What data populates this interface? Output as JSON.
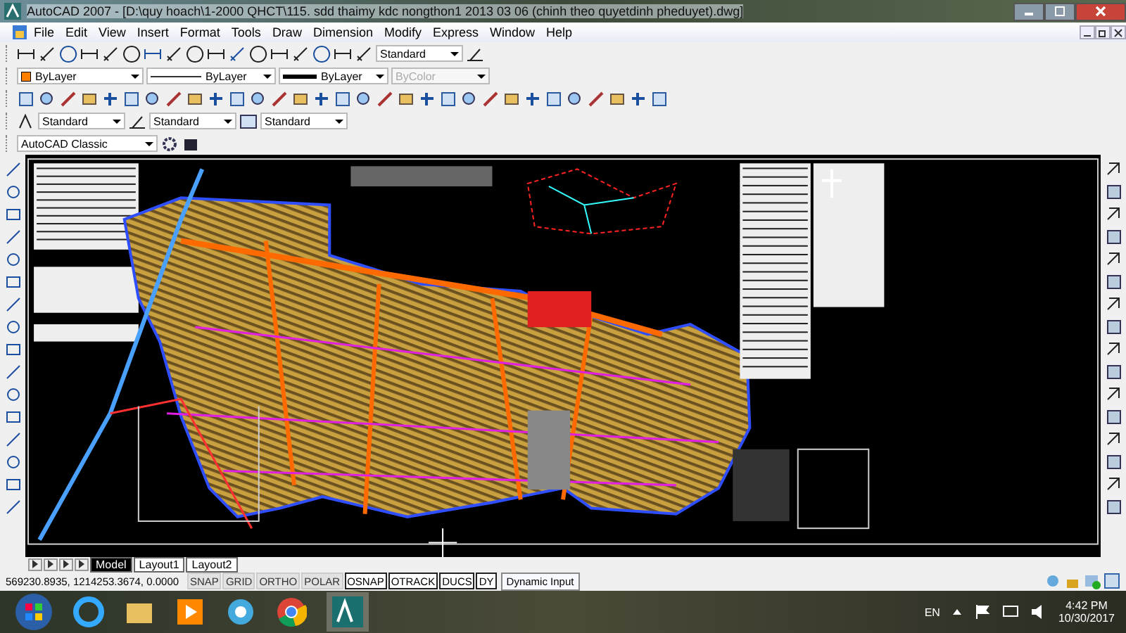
{
  "window": {
    "title": "AutoCAD 2007 - [D:\\quy hoach\\1-2000 QHCT\\115. sdd thaimy kdc nongthon1 2013 03 06 (chinh theo quyetdinh pheduyet).dwg]"
  },
  "menu": [
    "File",
    "Edit",
    "View",
    "Insert",
    "Format",
    "Tools",
    "Draw",
    "Dimension",
    "Modify",
    "Express",
    "Window",
    "Help"
  ],
  "toolbars": {
    "dimension_style": "Standard",
    "object_color": "ByLayer",
    "linetype": "ByLayer",
    "lineweight": "ByLayer",
    "plot_style": {
      "value": "ByColor",
      "disabled": true
    },
    "text_style": "Standard",
    "dim_style": "Standard",
    "table_style": "Standard",
    "workspace": "AutoCAD Classic"
  },
  "layout_tabs": [
    {
      "label": "Model",
      "selected": true
    },
    {
      "label": "Layout1",
      "selected": false
    },
    {
      "label": "Layout2",
      "selected": false
    }
  ],
  "status_bar": {
    "coordinates": "569230.8935, 1214253.3674, 0.0000",
    "toggles": [
      {
        "label": "SNAP",
        "on": false
      },
      {
        "label": "GRID",
        "on": false
      },
      {
        "label": "ORTHO",
        "on": false
      },
      {
        "label": "POLAR",
        "on": false
      },
      {
        "label": "OSNAP",
        "on": true
      },
      {
        "label": "OTRACK",
        "on": true
      },
      {
        "label": "DUCS",
        "on": true
      },
      {
        "label": "DY",
        "on": true
      }
    ],
    "tooltip": "Dynamic Input"
  },
  "tray": {
    "language": "EN",
    "time": "4:42 PM",
    "date": "10/30/2017"
  }
}
